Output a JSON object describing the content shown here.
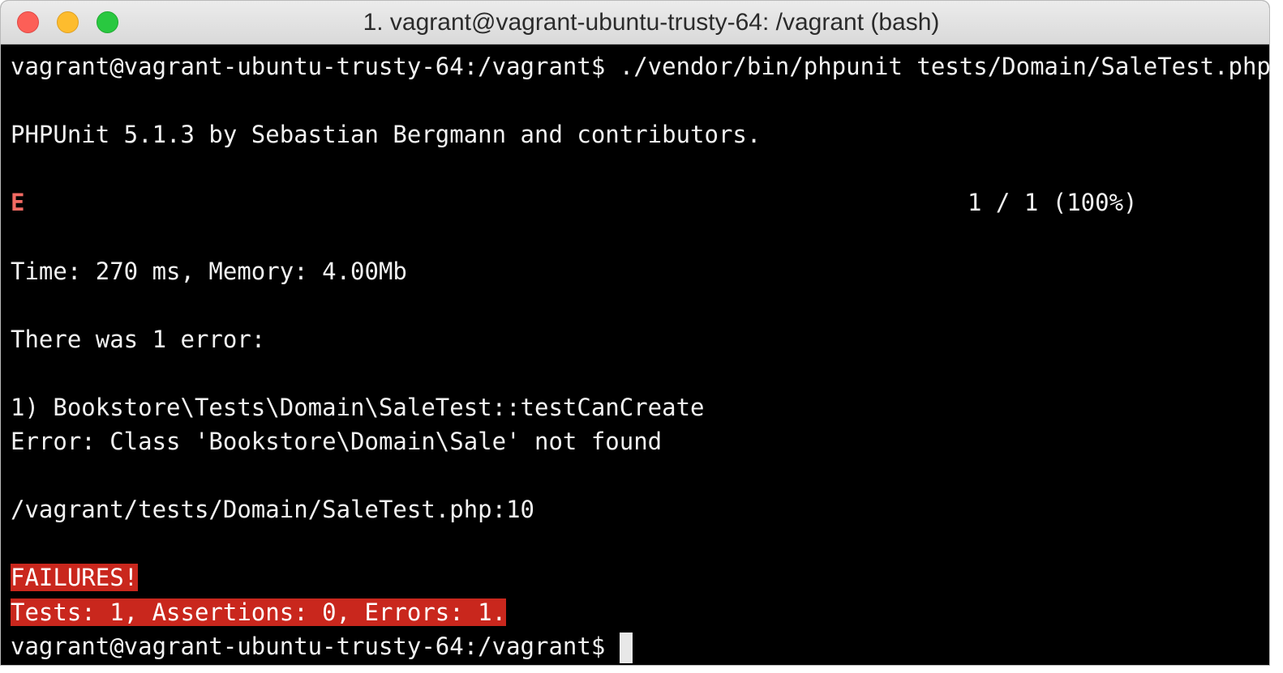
{
  "window": {
    "title": "1. vagrant@vagrant-ubuntu-trusty-64: /vagrant (bash)",
    "colors": {
      "close": "#fc5f57",
      "minimize": "#fdbc2e",
      "maximize": "#29c840",
      "terminal_bg": "#000000",
      "failure_bg": "#c9271d",
      "error_marker": "#f26a63"
    }
  },
  "terminal": {
    "command_line": "vagrant@vagrant-ubuntu-trusty-64:/vagrant$ ./vendor/bin/phpunit tests/Domain/SaleTest.php",
    "phpunit_banner": "PHPUnit 5.1.3 by Sebastian Bergmann and contributors.",
    "result_marker": "E",
    "progress": "1 / 1 (100%)",
    "time_memory": "Time: 270 ms, Memory: 4.00Mb",
    "error_count": "There was 1 error:",
    "error_test": "1) Bookstore\\Tests\\Domain\\SaleTest::testCanCreate",
    "error_message": "Error: Class 'Bookstore\\Domain\\Sale' not found",
    "error_location": "/vagrant/tests/Domain/SaleTest.php:10",
    "failures_label": "FAILURES!",
    "summary": "Tests: 1, Assertions: 0, Errors: 1.",
    "prompt": "vagrant@vagrant-ubuntu-trusty-64:/vagrant$"
  }
}
